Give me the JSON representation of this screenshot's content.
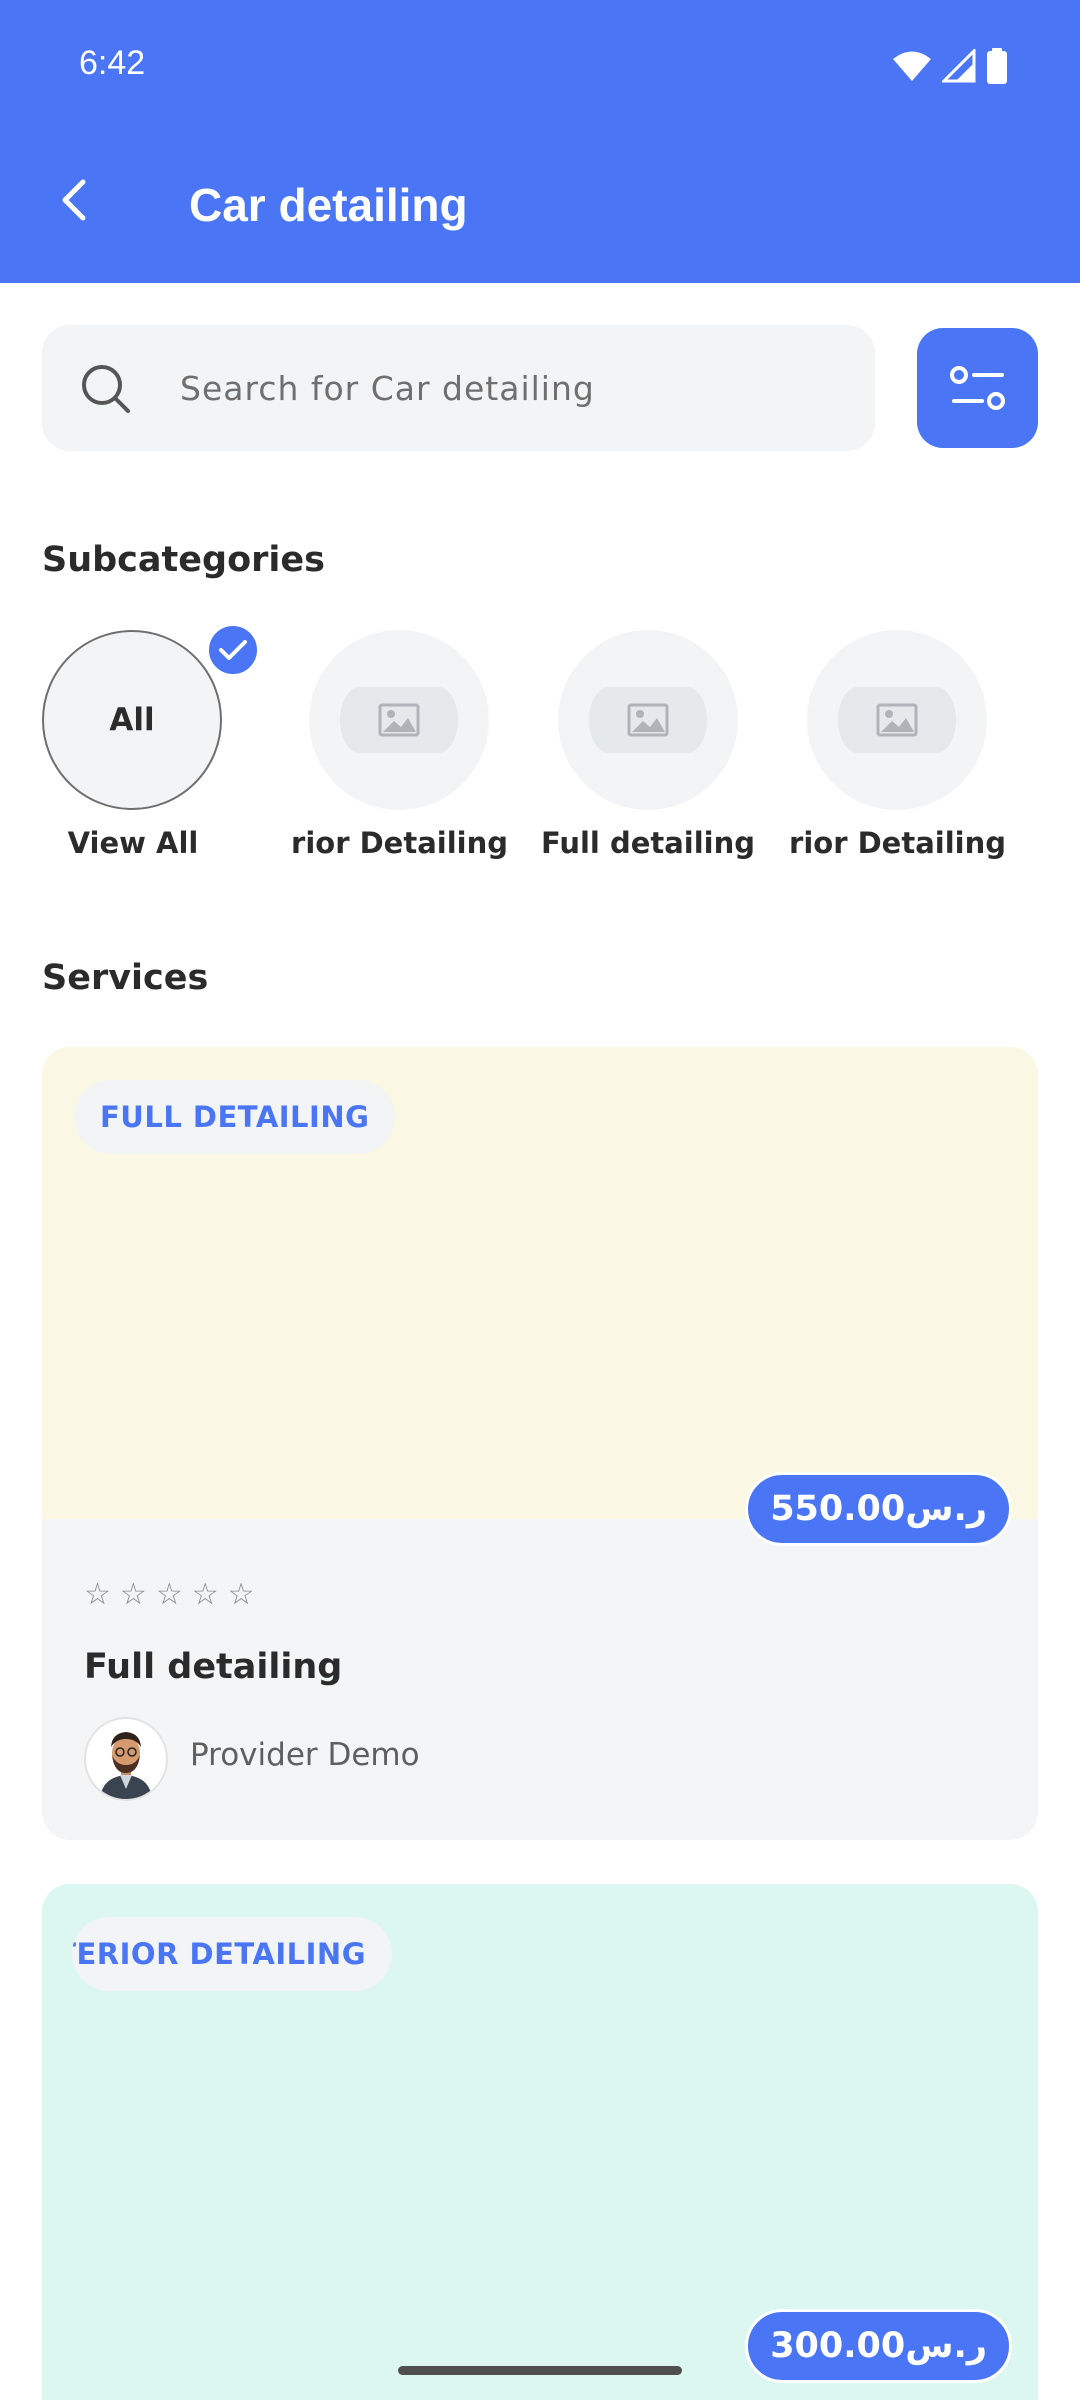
{
  "status_bar": {
    "time": "6:42"
  },
  "header": {
    "title": "Car detailing"
  },
  "search": {
    "placeholder": "Search for Car detailing"
  },
  "subcategories": {
    "title": "Subcategories",
    "items": [
      {
        "circle_text": "All",
        "label": "View All",
        "selected": true
      },
      {
        "label": "Interior Detailing"
      },
      {
        "label": "Full detailing"
      },
      {
        "label": "Exterior Detailing"
      }
    ]
  },
  "services": {
    "title": "Services",
    "cards": [
      {
        "category": "FULL DETAILING",
        "price": "550.00ر.س",
        "name": "Full detailing",
        "provider": "Provider Demo",
        "rating": 0,
        "bg": "#faf8e2"
      },
      {
        "category": "EXTERIOR DETAILING",
        "price": "300.00ر.س",
        "bg": "#dcf7ef"
      }
    ]
  },
  "colors": {
    "primary": "#4a76f5",
    "surface": "#f3f4f6"
  }
}
